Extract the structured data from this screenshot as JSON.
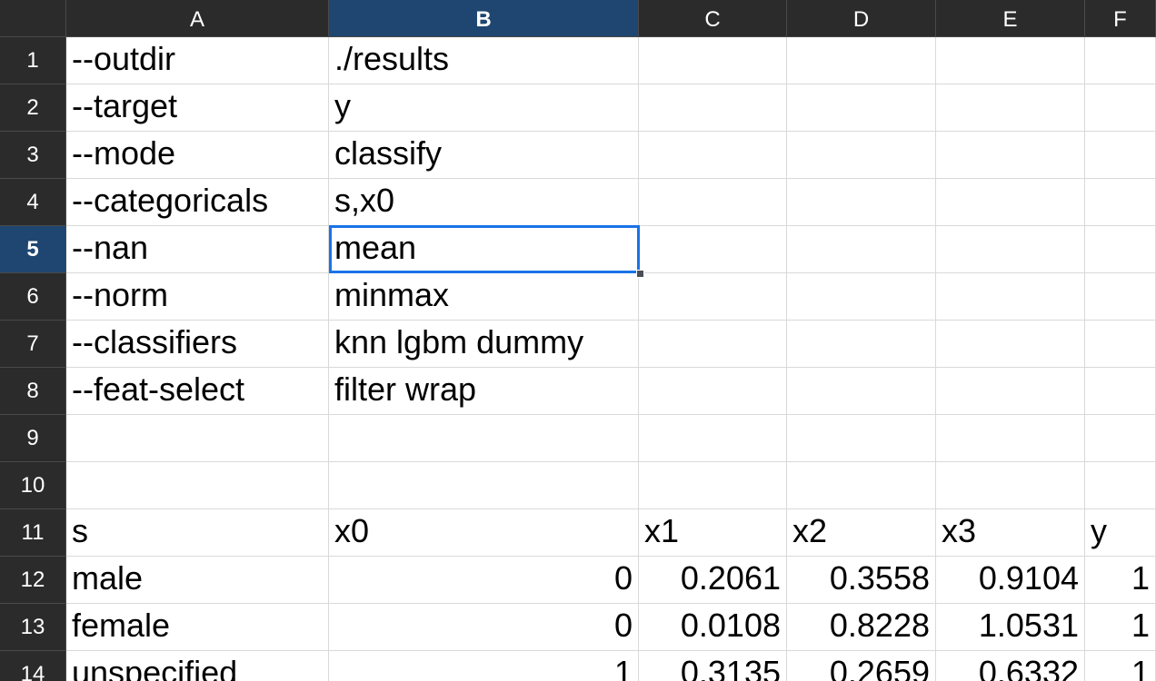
{
  "columns": [
    "A",
    "B",
    "C",
    "D",
    "E",
    "F"
  ],
  "selected_column": "B",
  "selected_row": "5",
  "rows": [
    {
      "num": "1",
      "cells": [
        "--outdir",
        "./results",
        "",
        "",
        "",
        ""
      ]
    },
    {
      "num": "2",
      "cells": [
        "--target",
        "y",
        "",
        "",
        "",
        ""
      ]
    },
    {
      "num": "3",
      "cells": [
        "--mode",
        "classify",
        "",
        "",
        "",
        ""
      ]
    },
    {
      "num": "4",
      "cells": [
        "--categoricals",
        "s,x0",
        "",
        "",
        "",
        ""
      ]
    },
    {
      "num": "5",
      "cells": [
        "--nan",
        "mean",
        "",
        "",
        "",
        ""
      ]
    },
    {
      "num": "6",
      "cells": [
        "--norm",
        "minmax",
        "",
        "",
        "",
        ""
      ]
    },
    {
      "num": "7",
      "cells": [
        "--classifiers",
        "knn lgbm dummy",
        "",
        "",
        "",
        ""
      ]
    },
    {
      "num": "8",
      "cells": [
        "--feat-select",
        "filter wrap",
        "",
        "",
        "",
        ""
      ]
    },
    {
      "num": "9",
      "cells": [
        "",
        "",
        "",
        "",
        "",
        ""
      ]
    },
    {
      "num": "10",
      "cells": [
        "",
        "",
        "",
        "",
        "",
        ""
      ]
    },
    {
      "num": "11",
      "cells": [
        "s",
        "x0",
        "x1",
        "x2",
        "x3",
        "y"
      ]
    },
    {
      "num": "12",
      "cells": [
        "male",
        "0",
        "0.2061",
        "0.3558",
        "0.9104",
        "1"
      ]
    },
    {
      "num": "13",
      "cells": [
        "female",
        "0",
        "0.0108",
        "0.8228",
        "1.0531",
        "1"
      ]
    },
    {
      "num": "14",
      "cells": [
        "unspecified",
        "1",
        "0.3135",
        "0.2659",
        "0.6332",
        "1"
      ]
    }
  ],
  "colors": {
    "header_bg": "#2b2b2b",
    "header_selected_bg": "#1e4671",
    "selection_border": "#1a73e8",
    "gridline": "#d9d9d9"
  }
}
